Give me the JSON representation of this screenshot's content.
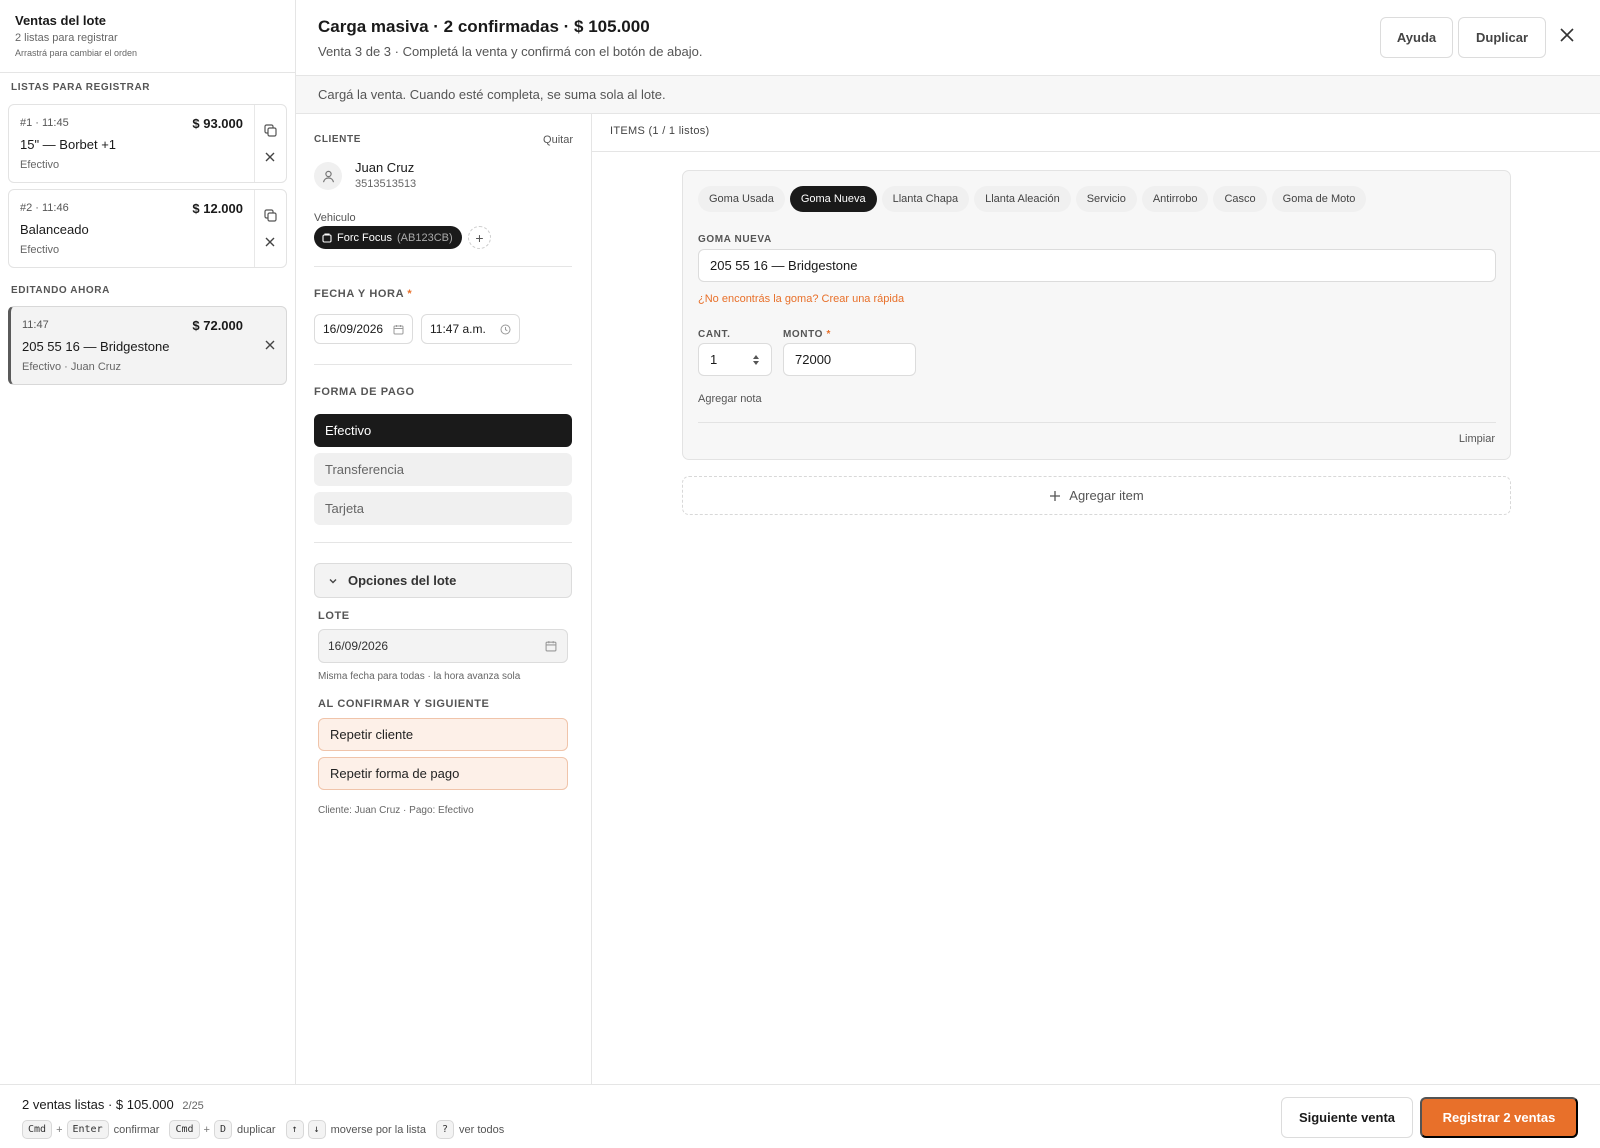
{
  "sidebar": {
    "title": "Ventas del lote",
    "subtitle": "2 listas para registrar",
    "hint": "Arrastrá para cambiar el orden",
    "ready_section": "LISTAS PARA REGISTRAR",
    "editing_section": "EDITANDO AHORA",
    "ready": [
      {
        "meta": "#1 · 11:45",
        "amount": "$ 93.000",
        "name": "15\" — Borbet +1",
        "pay": "Efectivo"
      },
      {
        "meta": "#2 · 11:46",
        "amount": "$ 12.000",
        "name": "Balanceado",
        "pay": "Efectivo"
      }
    ],
    "editing": {
      "meta": "11:47",
      "amount": "$ 72.000",
      "name": "205 55 16 — Bridgestone",
      "pay": "Efectivo · Juan Cruz"
    }
  },
  "header": {
    "title": "Carga masiva · 2 confirmadas · $ 105.000",
    "subtitle": "Venta 3 de 3 · Completá la venta y confirmá con el botón de abajo.",
    "help_label": "Ayuda",
    "duplicate_label": "Duplicar"
  },
  "banner": "Cargá la venta. Cuando esté completa, se suma sola al lote.",
  "client": {
    "section": "CLIENTE",
    "remove_label": "Quitar",
    "name": "Juan Cruz",
    "phone": "3513513513",
    "vehicle_label": "Vehiculo",
    "vehicle_name": "Forc Focus",
    "vehicle_plate": "(AB123CB)"
  },
  "datetime": {
    "label": "FECHA Y HORA",
    "required_mark": "*",
    "date": "16/09/2026",
    "time": "11:47 a.m."
  },
  "payment": {
    "label": "FORMA DE PAGO",
    "options": [
      "Efectivo",
      "Transferencia",
      "Tarjeta"
    ],
    "selected": "Efectivo"
  },
  "batch": {
    "accordion_label": "Opciones del lote",
    "lote_label": "LOTE",
    "lote_date": "16/09/2026",
    "lote_note": "Misma fecha para todas · la hora avanza sola",
    "confirm_label": "AL CONFIRMAR Y SIGUIENTE",
    "repeat_client": "Repetir cliente",
    "repeat_payment": "Repetir forma de pago",
    "summary": "Cliente: Juan Cruz · Pago: Efectivo"
  },
  "items": {
    "header": "ITEMS (1 / 1 listos)",
    "tabs": [
      "Goma Usada",
      "Goma Nueva",
      "Llanta Chapa",
      "Llanta Aleación",
      "Servicio",
      "Antirrobo",
      "Casco",
      "Goma de Moto"
    ],
    "selected_tab": "Goma Nueva",
    "product_label": "GOMA NUEVA",
    "product_value": "205 55 16 — Bridgestone",
    "create_link": "¿No encontrás la goma? Crear una rápida",
    "qty_label": "CANT.",
    "qty_value": "1",
    "amount_label": "MONTO",
    "amount_required": "*",
    "amount_value": "72000",
    "note_link": "Agregar nota",
    "clear_label": "Limpiar",
    "add_item_label": "Agregar item"
  },
  "footer": {
    "summary": "2 ventas listas · $ 105.000",
    "count": "2/25",
    "shortcuts": {
      "cmd": "Cmd",
      "plus": "+",
      "enter": "Enter",
      "confirm": "confirmar",
      "d": "D",
      "duplicate": "duplicar",
      "up": "↑",
      "down": "↓",
      "move": "moverse por la lista",
      "question": "?",
      "all": "ver todos"
    },
    "next_label": "Siguiente venta",
    "register_label": "Registrar 2 ventas"
  },
  "colors": {
    "accent": "#e8702a",
    "dark": "#1a1a1a",
    "toggle_bg": "#fdf0e8"
  },
  "icons": [
    "copy-icon",
    "close-icon",
    "user-icon",
    "car-icon",
    "plus-icon",
    "calendar-icon",
    "clock-icon",
    "chevron-down-icon",
    "stepper-icon"
  ]
}
